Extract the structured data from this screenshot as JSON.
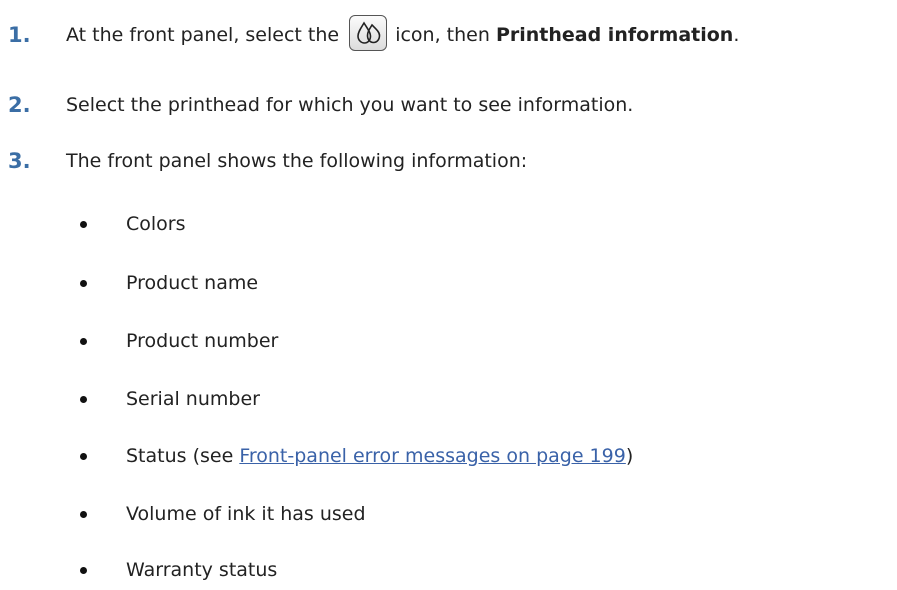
{
  "steps": [
    {
      "number": "1.",
      "text_before_icon": "At the front panel, select the",
      "icon": "ink-drops-icon",
      "text_after_icon": "icon, then",
      "bold_text": "Printhead information",
      "trailing": "."
    },
    {
      "number": "2.",
      "text": "Select the printhead for which you want to see information."
    },
    {
      "number": "3.",
      "text": "The front panel shows the following information:"
    }
  ],
  "bullets": [
    "Colors",
    "Product name",
    "Product number",
    "Serial number",
    {
      "prefix": "Status (see ",
      "link": "Front-panel error messages on page 199",
      "suffix": ")"
    },
    "Volume of ink it has used",
    "Warranty status"
  ],
  "colors": {
    "step_number": "#3b6ea5",
    "link": "#3a62a8",
    "text": "#222222"
  }
}
